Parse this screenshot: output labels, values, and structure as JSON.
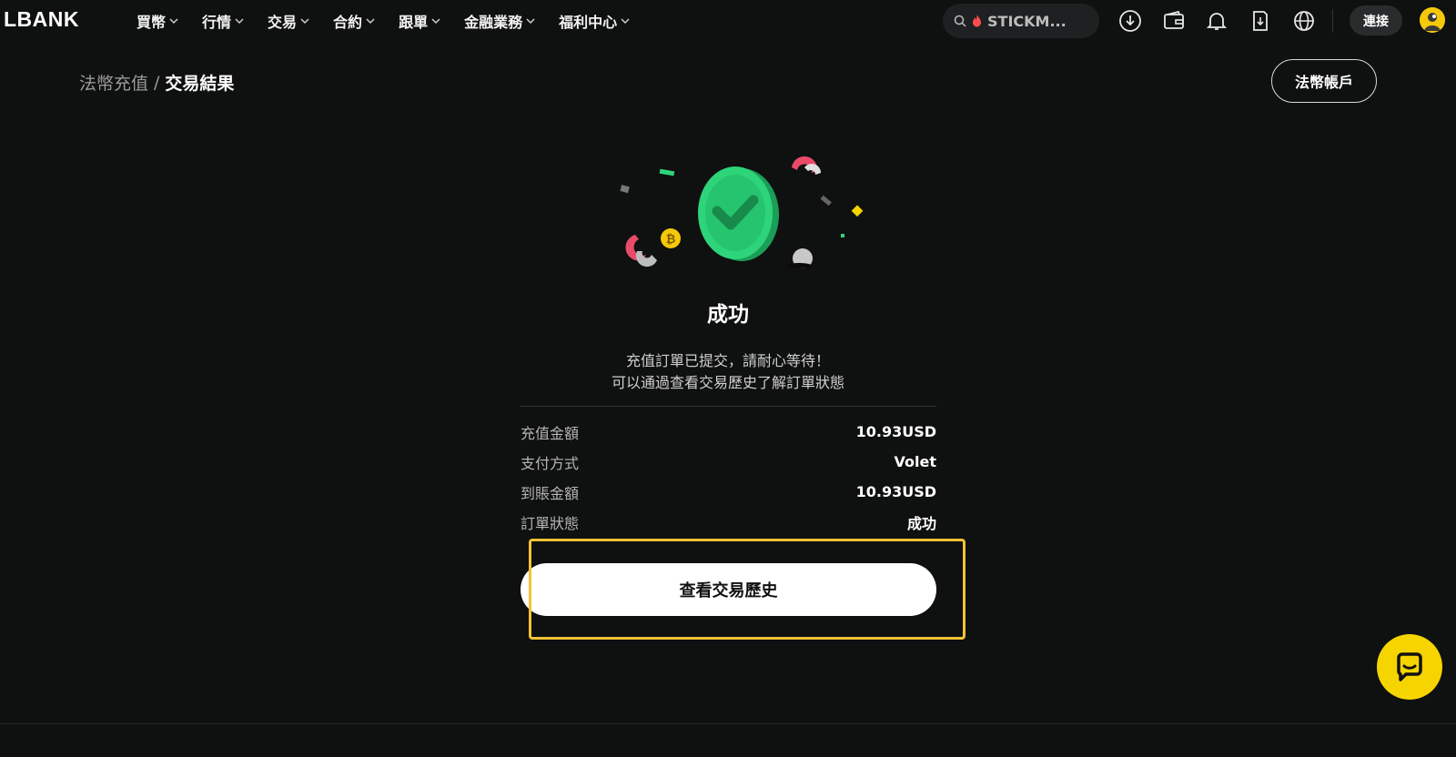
{
  "brand": {
    "logo_text": "LBANK",
    "accent": "#f6d400",
    "success_green": "#2ed47a"
  },
  "nav": {
    "items": [
      {
        "label": "買幣"
      },
      {
        "label": "行情"
      },
      {
        "label": "交易"
      },
      {
        "label": "合約"
      },
      {
        "label": "跟單"
      },
      {
        "label": "金融業務"
      },
      {
        "label": "福利中心"
      }
    ],
    "search_text": "STICKM...",
    "icons": [
      "download-icon",
      "wallet-icon",
      "bell-icon",
      "order-doc-icon",
      "globe-icon"
    ],
    "connect_label": "連接"
  },
  "breadcrumb": {
    "parent": "法幣充值",
    "separator": "/",
    "current": "交易結果"
  },
  "fiat_account_label": "法幣帳戶",
  "result": {
    "title": "成功",
    "message_line1": "充值訂單已提交，請耐心等待！",
    "message_line2": "可以通過查看交易歷史了解訂單狀態"
  },
  "details": [
    {
      "label": "充值金額",
      "value": "10.93USD"
    },
    {
      "label": "支付方式",
      "value": "Volet"
    },
    {
      "label": "到賬金額",
      "value": "10.93USD"
    },
    {
      "label": "訂單狀態",
      "value": "成功"
    }
  ],
  "history_button_label": "查看交易歷史"
}
